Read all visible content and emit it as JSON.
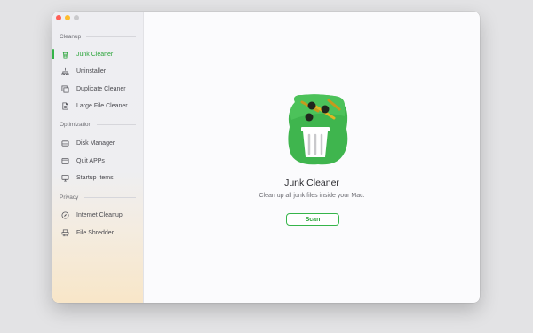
{
  "sidebar": {
    "sections": {
      "cleanup": "Cleanup",
      "optimization": "Optimization",
      "privacy": "Privacy"
    },
    "items": [
      {
        "label": "Junk Cleaner",
        "icon": "trash-icon"
      },
      {
        "label": "Uninstaller",
        "icon": "uninstaller-icon"
      },
      {
        "label": "Duplicate Cleaner",
        "icon": "duplicate-icon"
      },
      {
        "label": "Large File Cleaner",
        "icon": "large-file-icon"
      },
      {
        "label": "Disk Manager",
        "icon": "disk-icon"
      },
      {
        "label": "Quit APPs",
        "icon": "quit-apps-icon"
      },
      {
        "label": "Startup Items",
        "icon": "monitor-icon"
      },
      {
        "label": "Internet Cleanup",
        "icon": "compass-icon"
      },
      {
        "label": "File Shredder",
        "icon": "shredder-icon"
      }
    ],
    "active_index": 0
  },
  "main": {
    "title": "Junk Cleaner",
    "subtitle": "Clean up all junk files inside your Mac.",
    "scan_label": "Scan"
  },
  "colors": {
    "accent": "#35b449",
    "active_text": "#2aa43a"
  }
}
